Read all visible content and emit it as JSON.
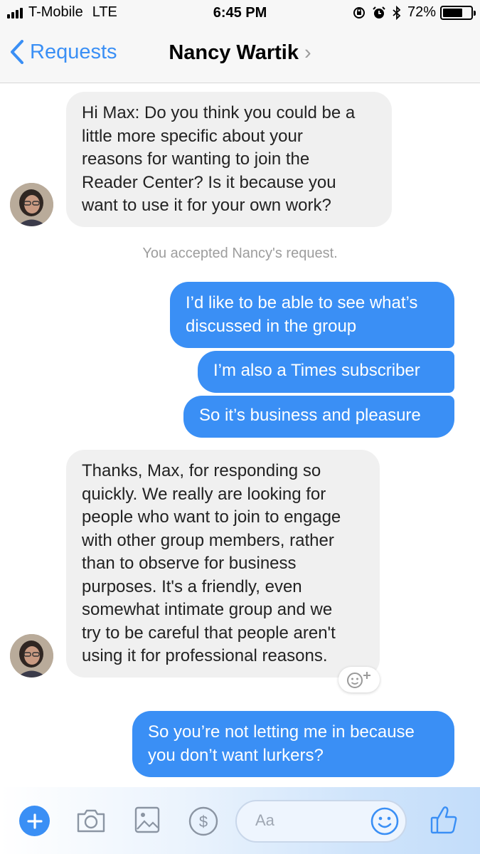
{
  "status_bar": {
    "carrier": "T-Mobile",
    "network": "LTE",
    "time": "6:45 PM",
    "battery_text": "72%",
    "battery_level": 0.72
  },
  "nav": {
    "back_label": "Requests",
    "title": "Nancy Wartik",
    "title_chevron": "›"
  },
  "messages": {
    "m1": [
      "Hi Max: Do you think you could be a",
      "little more specific about your",
      "reasons for wanting to join the",
      "Reader Center? Is it because you",
      "want to use it for your own work?"
    ],
    "meta": "You accepted Nancy's request.",
    "m2": [
      "I’d like to be able to see what’s",
      "discussed in the group"
    ],
    "m3": "I’m also a Times subscriber",
    "m4": "So it’s business and pleasure",
    "m5": [
      "Thanks, Max, for responding so",
      "quickly. We really are looking for",
      "people who want to join to engage",
      "with other group members, rather",
      "than to observe for business",
      "purposes. It's a friendly, even",
      "somewhat intimate group and we",
      "try to be careful that people aren't",
      "using it for professional reasons."
    ],
    "m6": [
      "So you’re not letting me in because",
      "you don’t want lurkers?"
    ]
  },
  "composer": {
    "placeholder": "Aa",
    "icons": [
      "plus-icon",
      "camera-icon",
      "photo-icon",
      "dollar-icon",
      "emoji-icon",
      "thumbs-up-icon"
    ]
  },
  "colors": {
    "accent": "#3a8ff5",
    "incoming_bubble": "#f0f0f0",
    "meta_text": "#9d9d9d",
    "bar_background": "#f7f7f7"
  }
}
